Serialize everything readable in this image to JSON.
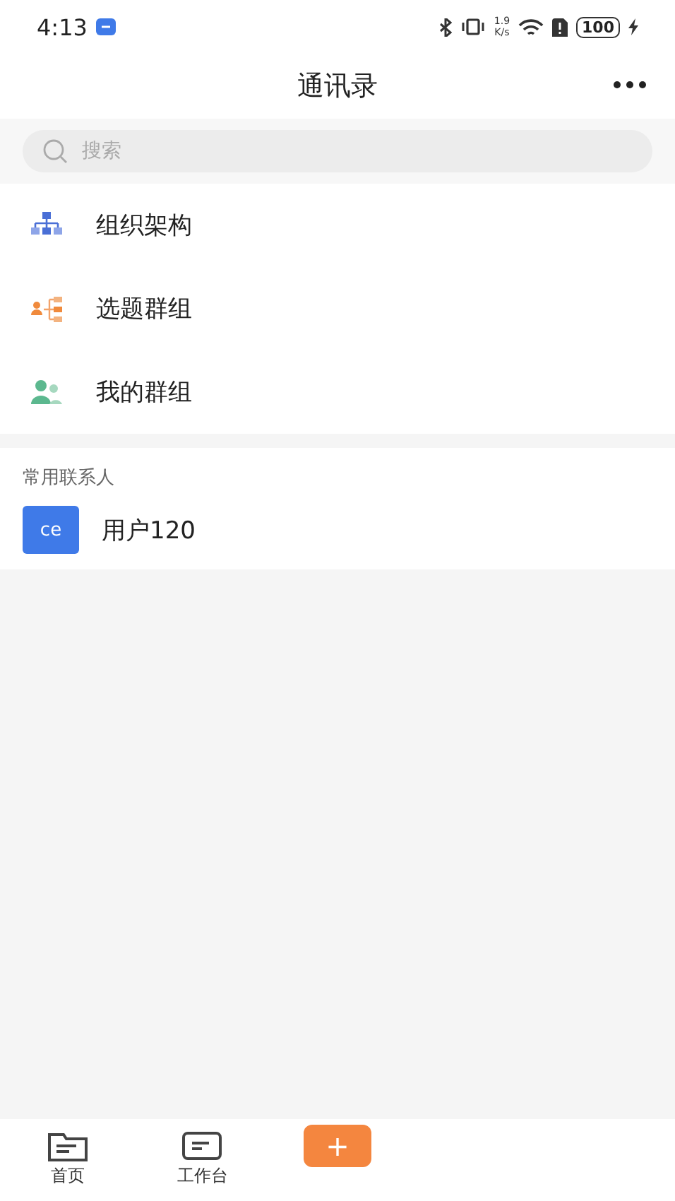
{
  "status_bar": {
    "time": "4:13",
    "speed_value": "1.9",
    "speed_unit": "K/s",
    "battery": "100"
  },
  "header": {
    "title": "通讯录"
  },
  "search": {
    "placeholder": "搜索"
  },
  "menu": [
    {
      "label": "组织架构",
      "kind": "org"
    },
    {
      "label": "选题群组",
      "kind": "topic"
    },
    {
      "label": "我的群组",
      "kind": "group"
    }
  ],
  "frequent_contacts": {
    "heading": "常用联系人",
    "contacts": [
      {
        "avatar": "ce",
        "name": "用户120"
      }
    ]
  },
  "tab_bar": [
    {
      "label": "首页",
      "kind": "home"
    },
    {
      "label": "工作台",
      "kind": "work"
    },
    {
      "label": "+",
      "kind": "add"
    }
  ]
}
